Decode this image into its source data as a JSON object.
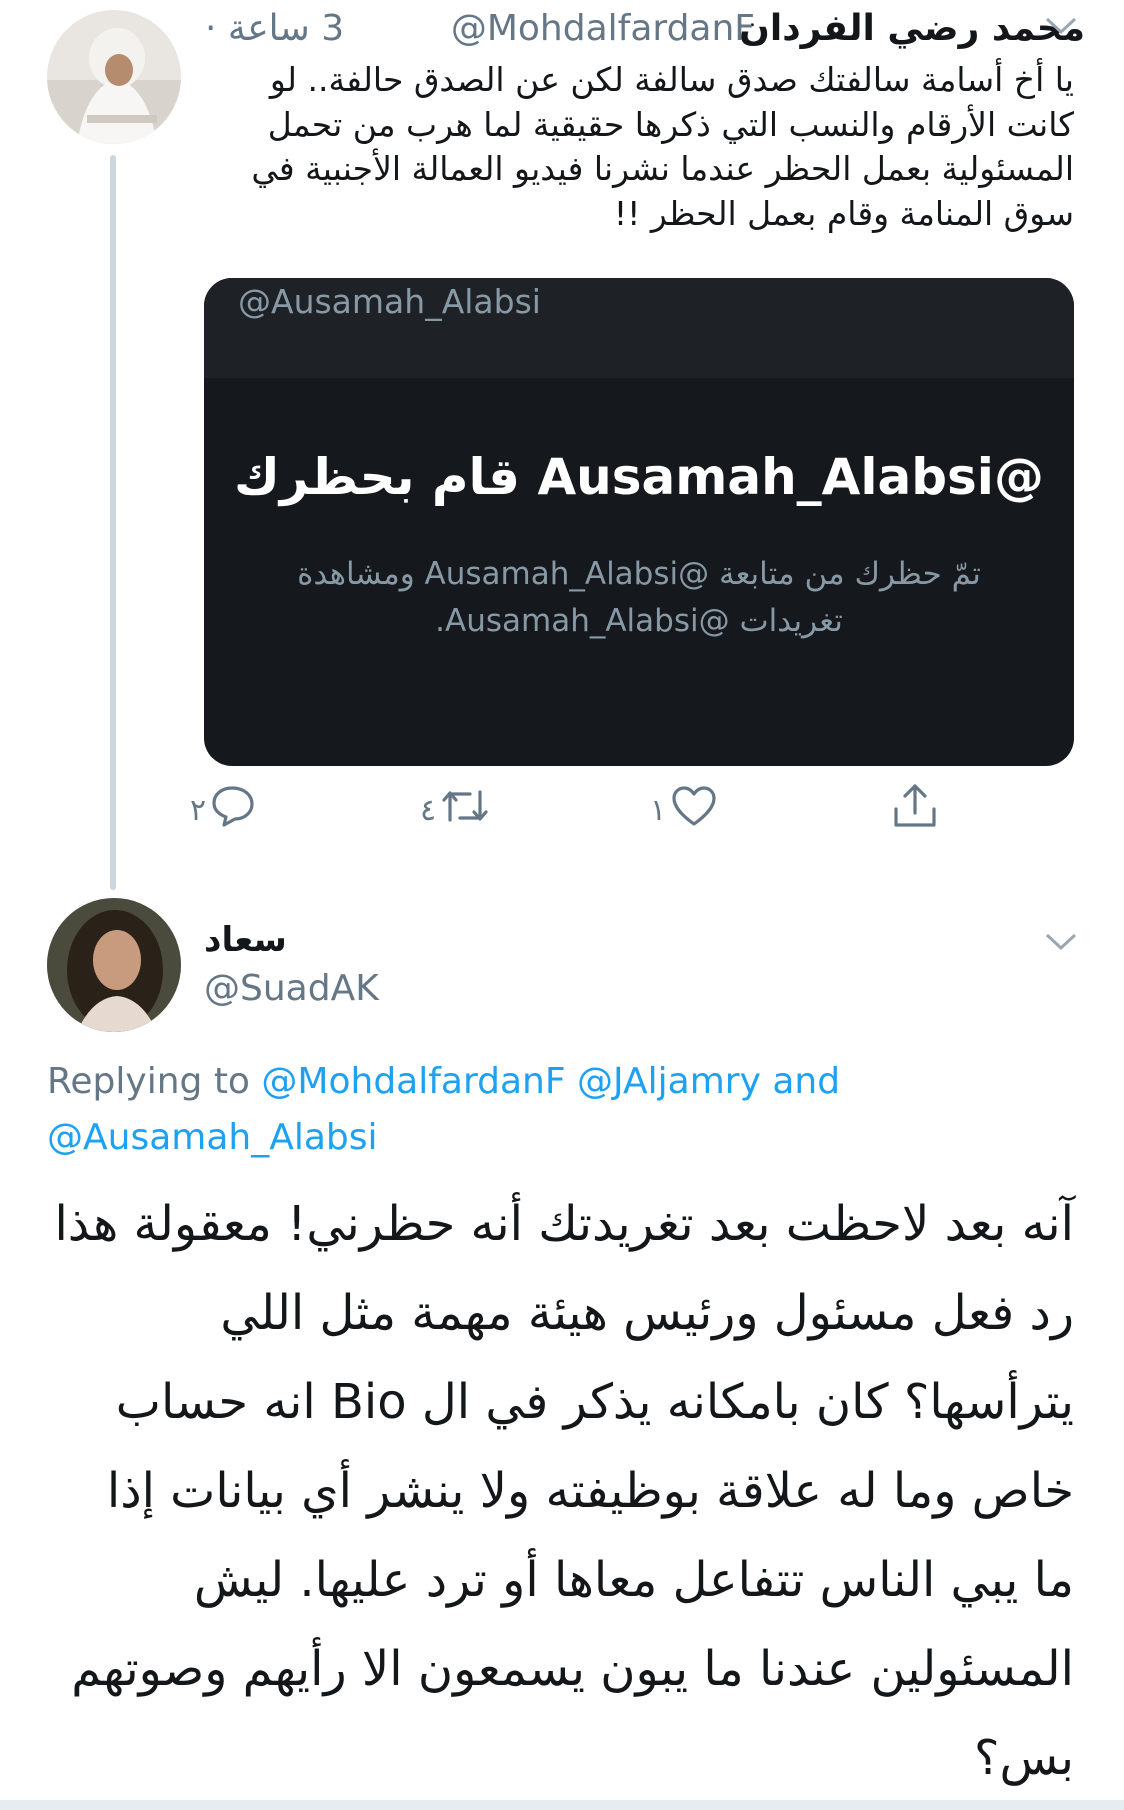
{
  "tweet1": {
    "name": "محمد رضي الفردان",
    "handle": "@MohdalfardanF",
    "time": "3 ساعة ·",
    "text": "يا أخ أسامة سالفتك صدق سالفة لكن عن الصدق حالفة.. لو كانت الأرقام والنسب التي ذكرها حقيقية لما هرب من تحمل المسئولية بعمل الحظر عندما نشرنا فيديو العمالة الأجنبية في سوق المنامة وقام بعمل الحظر !!",
    "card": {
      "handle": "@Ausamah_Alabsi",
      "title": "@Ausamah_Alabsi قام بحظرك",
      "subtitle": "تمّ حظرك من متابعة @Ausamah_Alabsi ومشاهدة تغريدات @Ausamah_Alabsi."
    },
    "actions": {
      "reply_count": "٢",
      "retweet_count": "٤",
      "like_count": "١"
    }
  },
  "tweet2": {
    "name": "سعاد",
    "handle": "@SuadAK",
    "replying_prefix": "Replying to",
    "replying_mention1": "@MohdalfardanF",
    "replying_mention2": "@JAljamry",
    "replying_and": "and",
    "replying_mention3": "@Ausamah_Alabsi",
    "text": "آنه بعد لاحظت بعد تغريدتك أنه حظرني! معقولة هذا رد فعل مسئول ورئيس هيئة مهمة مثل اللي يترأسها؟ كان بامكانه يذكر في ال Bio انه حساب خاص وما له علاقة بوظيفته ولا ينشر أي بيانات إذا ما يبي الناس تتفاعل معاها أو ترد عليها. ليش المسئولين عندنا ما يبون يسمعون الا رأيهم وصوتهم بس؟"
  },
  "colors": {
    "accent": "#1da1f2",
    "muted": "#657786",
    "card_bg": "#15181c"
  }
}
